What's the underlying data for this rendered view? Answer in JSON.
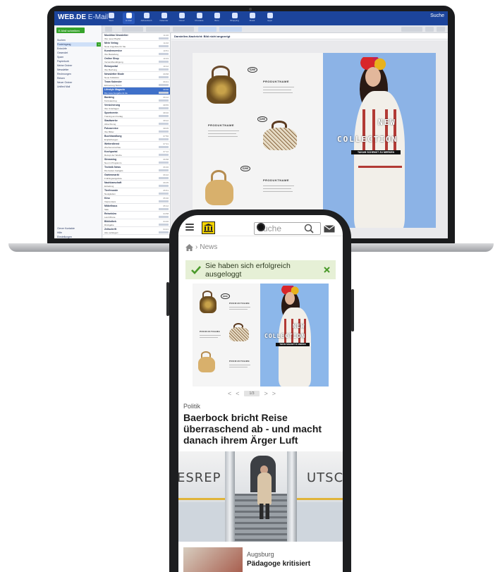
{
  "laptop": {
    "app": {
      "logo": "WEB.DE",
      "title": "E-Mail"
    },
    "nav": [
      {
        "label": "Start",
        "icon": "home-icon"
      },
      {
        "label": "E-Mail",
        "icon": "mail-icon",
        "active": true
      },
      {
        "label": "Adressbuch",
        "icon": "contacts-icon"
      },
      {
        "label": "Kalender",
        "icon": "calendar-icon"
      },
      {
        "label": "Cloud",
        "icon": "cloud-icon"
      },
      {
        "label": "Produkte",
        "icon": "products-icon"
      },
      {
        "label": "Büro",
        "icon": "office-icon"
      },
      {
        "label": "Shopping",
        "icon": "shopping-icon"
      },
      {
        "label": "Musik",
        "icon": "music-icon"
      },
      {
        "label": "Apps",
        "icon": "apps-icon"
      }
    ],
    "top_right": "Suche",
    "new_mail_button": "E-Mail schreiben",
    "folders": [
      {
        "label": "Suchen"
      },
      {
        "label": "Posteingang",
        "active": true,
        "count": "3"
      },
      {
        "label": "Entwürfe"
      },
      {
        "label": "Gesendet"
      },
      {
        "label": "Spam"
      },
      {
        "label": "Papierkorb"
      },
      {
        "label": "Meine Ordner"
      },
      {
        "label": "Newsletter"
      },
      {
        "label": "Rechnungen"
      },
      {
        "label": "Reisen"
      },
      {
        "label": "Neuer Ordner"
      },
      {
        "label": "Unified Mail"
      }
    ],
    "sidebar_footer": [
      "Clever Kontakte",
      "Hilfe",
      "Einstellungen"
    ],
    "messages": [
      {
        "sender": "Musikfan Newsletter",
        "subject": "Ihre neue Playlist",
        "time": "11:20"
      },
      {
        "sender": "Mein Verlag",
        "subject": "Neue Angebote für Sie",
        "time": "11:02"
      },
      {
        "sender": "Kundenservice",
        "subject": "Ihre Bestellung",
        "time": "10:51"
      },
      {
        "sender": "Online Shop",
        "subject": "Versandbestätigung",
        "time": "10:33"
      },
      {
        "sender": "Reiseportal",
        "subject": "Ihre Buchung",
        "time": "10:12"
      },
      {
        "sender": "Newsletter Mode",
        "subject": "Neue Kollektion",
        "time": "09:58"
      },
      {
        "sender": "Team Kalender",
        "subject": "Erinnerung Termin",
        "time": "09:41"
      },
      {
        "sender": "Lifestyle Magazin",
        "subject": "Die neue Ausgabe ist da",
        "time": "09:30",
        "selected": true
      },
      {
        "sender": "Banking",
        "subject": "Kontoauszug",
        "time": "09:12"
      },
      {
        "sender": "Versicherung",
        "subject": "Ihre Unterlagen",
        "time": "08:55"
      },
      {
        "sender": "Sportverein",
        "subject": "Training am Freitag",
        "time": "08:40"
      },
      {
        "sender": "Stadtwerke",
        "subject": "Abrechnung",
        "time": "08:22"
      },
      {
        "sender": "Fotoservice",
        "subject": "Ihre Bilder",
        "time": "08:05"
      },
      {
        "sender": "Buchhandlung",
        "subject": "Empfehlungen",
        "time": "07:50"
      },
      {
        "sender": "Wetterdienst",
        "subject": "Wochenvorschau",
        "time": "07:31"
      },
      {
        "sender": "Kochportal",
        "subject": "Rezept der Woche",
        "time": "07:12"
      },
      {
        "sender": "Streaming",
        "subject": "Neu im Programm",
        "time": "06:58"
      },
      {
        "sender": "Technik News",
        "subject": "Die besten Gadgets",
        "time": "06:40"
      },
      {
        "sender": "Gartenmarkt",
        "subject": "Frühlingsangebote",
        "time": "06:22"
      },
      {
        "sender": "Nachbarschaft",
        "subject": "Einladung",
        "time": "06:05"
      },
      {
        "sender": "Tierfreunde",
        "subject": "Neuigkeiten",
        "time": "05:51"
      },
      {
        "sender": "Kino",
        "subject": "Vorpremiere",
        "time": "05:30"
      },
      {
        "sender": "Möbelhaus",
        "subject": "Sale",
        "time": "05:12"
      },
      {
        "sender": "Reisebüro",
        "subject": "Last Minute",
        "time": "04:58"
      },
      {
        "sender": "Bibliothek",
        "subject": "Rückgabe",
        "time": "04:40"
      },
      {
        "sender": "Zeitschrift",
        "subject": "Abo verlängert",
        "time": "04:21"
      }
    ],
    "reading_title": "Darstellen-Nachricht: Bild nicht angezeigt",
    "catalog": {
      "prices": [
        "€299",
        "€299",
        "€299"
      ],
      "product_title": "PRODUKTNAME",
      "headline_1": "NEW",
      "headline_2": "COLLECTION",
      "tag": "TAKUM SCHENKT ZU MERKEN"
    }
  },
  "phone": {
    "search_placeholder": "Suche",
    "breadcrumb": "News",
    "notice": "Sie haben sich erfolgreich ausgeloggt",
    "catalog": {
      "price": "€299",
      "product_title": "PRODUKTNAME",
      "headline_1": "NEW",
      "headline_2": "COLLECTION",
      "tag": "TAKUM SCHENKT ZU MERKEN"
    },
    "pager": {
      "prev": "<",
      "prev2": "<",
      "page": "1/3",
      "next": ">",
      "next2": ">"
    },
    "article": {
      "category": "Politik",
      "headline": "Baerbock bricht Reise überraschend ab - und macht danach ihrem Ärger Luft",
      "plane_text_left": "ESREP",
      "plane_text_right": "UTSC"
    },
    "teaser": {
      "city": "Augsburg",
      "title": "Pädagoge kritisiert"
    }
  }
}
